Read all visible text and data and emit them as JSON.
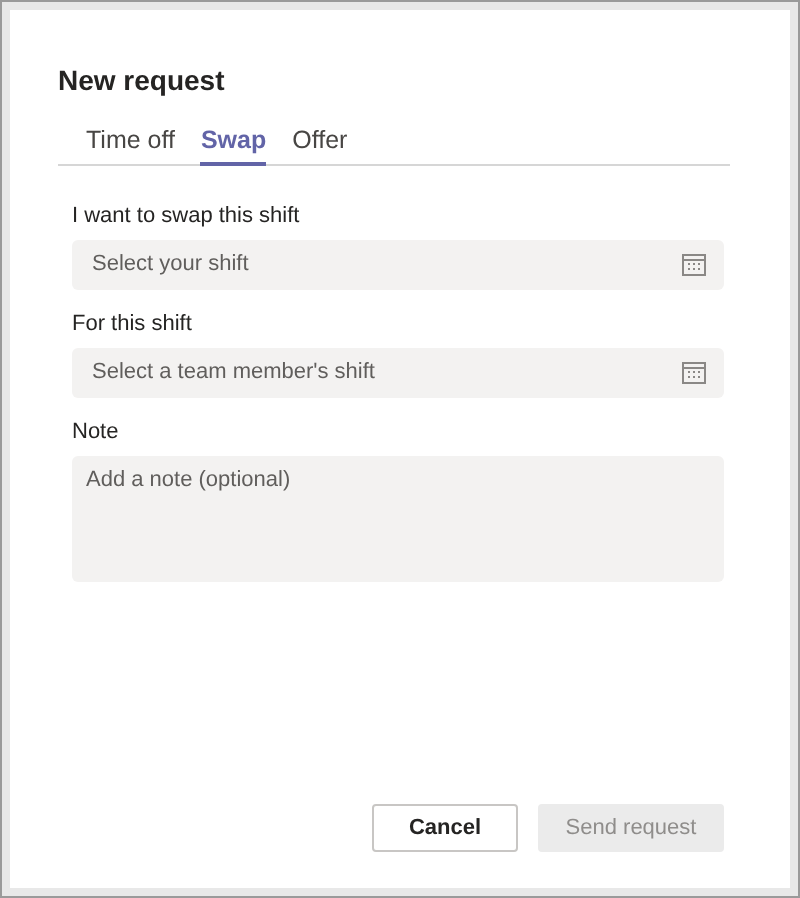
{
  "dialog": {
    "title": "New request"
  },
  "tabs": [
    {
      "label": "Time off",
      "selected": false
    },
    {
      "label": "Swap",
      "selected": true
    },
    {
      "label": "Offer",
      "selected": false
    }
  ],
  "fields": [
    {
      "kind": "picker",
      "label": "I want to swap this shift",
      "placeholder": "Select your shift"
    },
    {
      "kind": "picker",
      "label": "For this shift",
      "placeholder": "Select a team member's shift"
    },
    {
      "kind": "textarea",
      "label": "Note",
      "placeholder": "Add a note (optional)"
    }
  ],
  "buttons": [
    {
      "label": "Cancel",
      "disabled": false
    },
    {
      "label": "Send request",
      "disabled": true
    }
  ]
}
